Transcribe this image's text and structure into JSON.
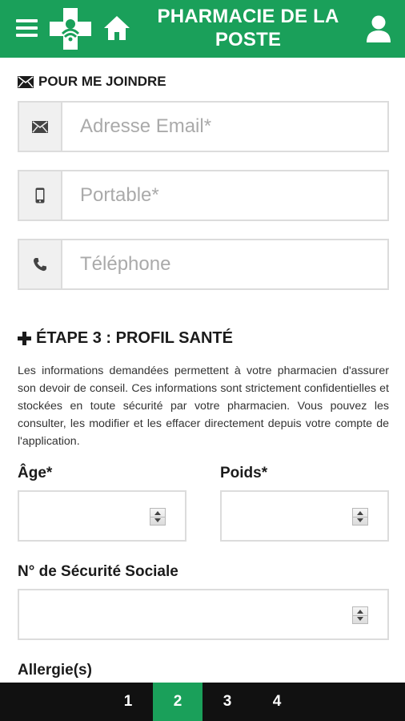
{
  "header": {
    "title": "PHARMACIE DE LA POSTE",
    "menu_icon": "hamburger-menu-icon",
    "logo": "pharmacy-cross-logo",
    "home_icon": "home-icon",
    "user_icon": "user-icon",
    "color": "#1aa05a"
  },
  "contact": {
    "title": "POUR ME JOINDRE",
    "title_icon": "envelope-icon",
    "fields": [
      {
        "icon": "envelope-icon",
        "placeholder": "Adresse Email*",
        "value": ""
      },
      {
        "icon": "mobile-phone-icon",
        "placeholder": "Portable*",
        "value": ""
      },
      {
        "icon": "telephone-icon",
        "placeholder": "Téléphone",
        "value": ""
      }
    ]
  },
  "step3": {
    "title": "ÉTAPE 3 : PROFIL SANTÉ",
    "title_icon": "plus-icon",
    "description": "Les informations demandées permettent à votre pharmacien d'assurer son devoir de conseil. Ces informations sont strictement confidentielles et stockées en toute sécurité par votre pharmacien. Vous pouvez les consulter, les modifier et les effacer directement depuis votre compte de l'application.",
    "age_label": "Âge*",
    "weight_label": "Poids*",
    "ssn_label": "N° de Sécurité Sociale",
    "allergies_label": "Allergie(s)"
  },
  "steps_nav": {
    "items": [
      "1",
      "2",
      "3",
      "4"
    ],
    "active_index": 1,
    "active_color": "#1aa05a"
  }
}
